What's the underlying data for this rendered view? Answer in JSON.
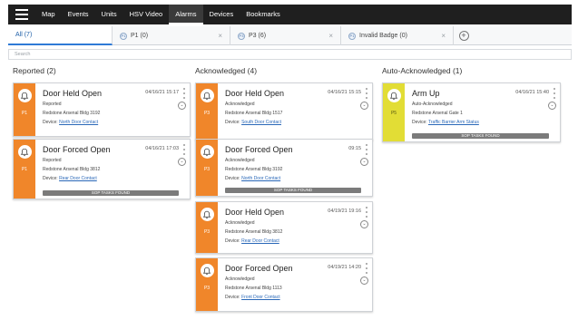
{
  "nav": {
    "menu_icon": "hamburger-icon",
    "items": [
      "Map",
      "Events",
      "Units",
      "HSV Video",
      "Alarms",
      "Devices",
      "Bookmarks"
    ],
    "active": "Alarms"
  },
  "tabs": [
    {
      "label": "All (7)",
      "active": true
    },
    {
      "priority": "P1",
      "label": "P1 (0)"
    },
    {
      "priority": "P3",
      "label": "P3 (6)"
    },
    {
      "priority": "P1",
      "label": "Invalid Badge (0)"
    }
  ],
  "tab_close": "×",
  "tab_add": "+",
  "search": {
    "placeholder": "Search"
  },
  "columns": [
    {
      "title": "Reported (2)",
      "cards": [
        {
          "title": "Door Held Open",
          "time": "04/16/21 15:17",
          "status": "Reported",
          "location": "Redstone Arsenal Bldg 3192",
          "device_label": "Device:",
          "device": "North Door Contact",
          "priority": "P1",
          "sop": ""
        },
        {
          "title": "Door Forced Open",
          "time": "04/16/21 17:03",
          "status": "Reported",
          "location": "Redstone Arsenal Bldg 3812",
          "device_label": "Device:",
          "device": "Rear Door Contact",
          "priority": "P1",
          "sop": "SOP TASKS FOUND"
        }
      ]
    },
    {
      "title": "Acknowledged (4)",
      "cards": [
        {
          "title": "Door Held Open",
          "time": "04/16/21 15:15",
          "status": "Acknowledged",
          "location": "Redstone Arsenal Bldg 1517",
          "device_label": "Device:",
          "device": "South Door Contact",
          "priority": "P3",
          "sop": ""
        },
        {
          "title": "Door Forced Open",
          "time": "09:15",
          "status": "Acknowledged",
          "location": "Redstone Arsenal Bldg 3192",
          "device_label": "Device:",
          "device": "North Door Contact",
          "priority": "P3",
          "sop": "SOP TASKS FOUND"
        },
        {
          "title": "Door Held Open",
          "time": "04/19/21 19:16",
          "status": "Acknowledged",
          "location": "Redstone Arsenal Bldg 3812",
          "device_label": "Device:",
          "device": "Rear Door Contact",
          "priority": "P3",
          "sop": ""
        },
        {
          "title": "Door Forced Open",
          "time": "04/19/21 14:20",
          "status": "Acknowledged",
          "location": "Redstone Arsenal Bldg 1113",
          "device_label": "Device:",
          "device": "Front Door Contact",
          "priority": "P3",
          "sop": ""
        }
      ]
    },
    {
      "title": "Auto-Acknowledged (1)",
      "cards": [
        {
          "title": "Arm Up",
          "time": "04/16/21 15:40",
          "status": "Auto-Acknowledged",
          "location": "Redstone Arsenal Gate 1",
          "device_label": "Device:",
          "device": "Traffic Barrier Arm Status",
          "priority": "P5",
          "sop": "SOP TASKS FOUND",
          "color": "yellow"
        }
      ]
    }
  ],
  "expand_glyph": "⌄",
  "colors": {
    "priority_orange": "#f0862a",
    "priority_yellow": "#e2dd35",
    "topbar": "#1f1f1f",
    "link": "#2a68b8"
  }
}
